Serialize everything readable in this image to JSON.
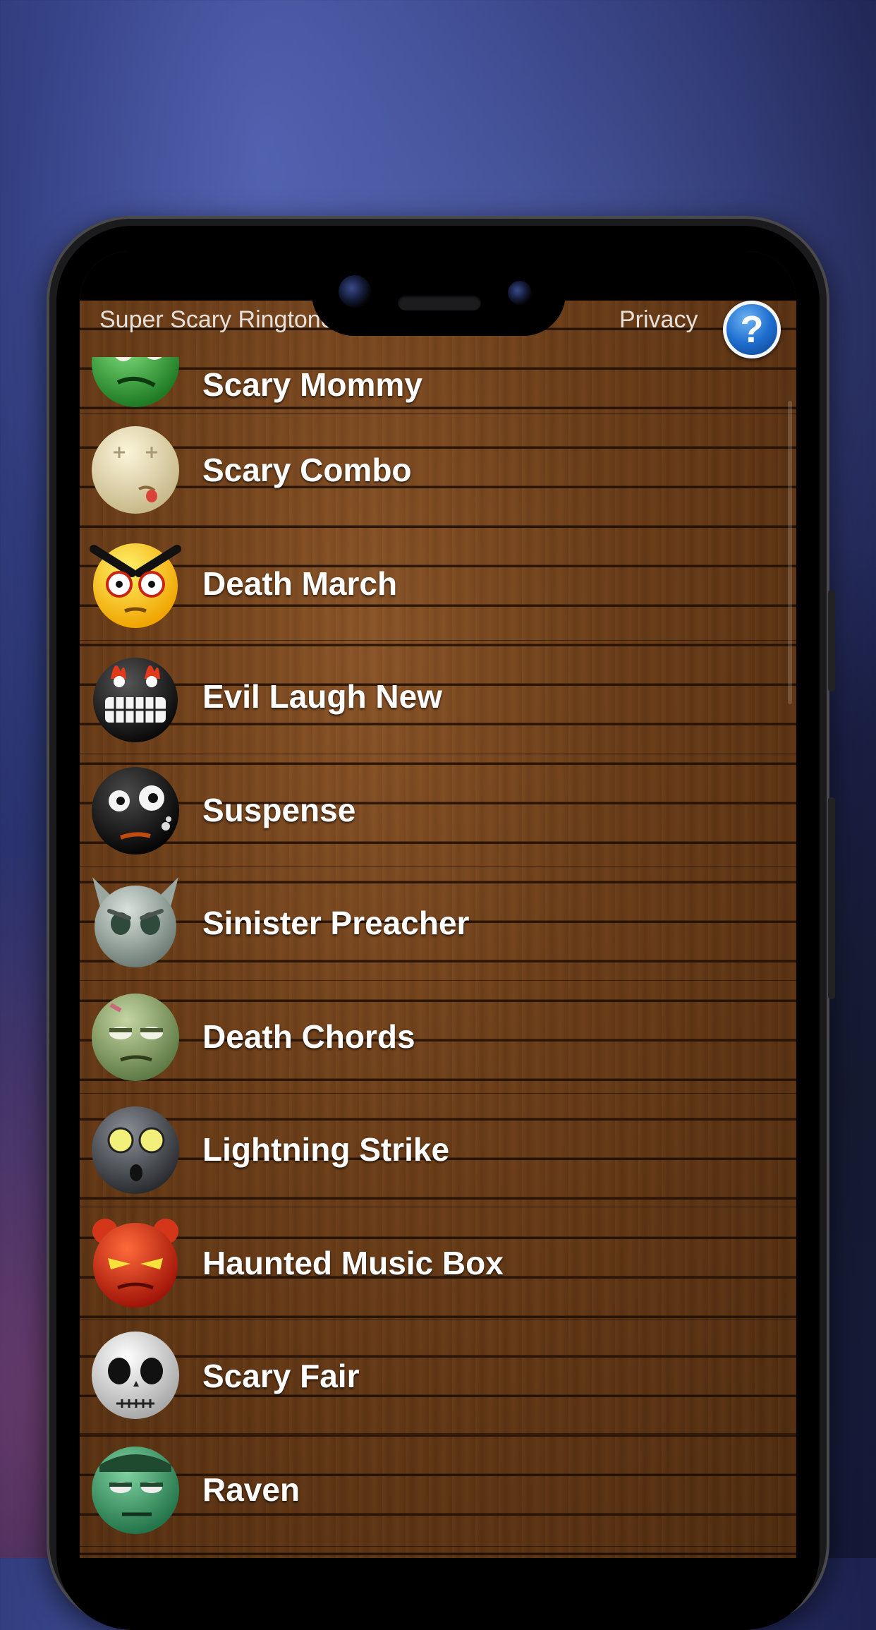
{
  "app": {
    "title": "Super Scary Ringtones",
    "privacy_label": "Privacy",
    "help_label": "?"
  },
  "ringtones": [
    {
      "name": "Scary Mommy",
      "icon": "green-zombie-face-icon"
    },
    {
      "name": "Scary Combo",
      "icon": "pale-dead-face-icon"
    },
    {
      "name": "Death March",
      "icon": "angry-yellow-face-icon"
    },
    {
      "name": "Evil Laugh New",
      "icon": "black-fire-eyed-face-icon"
    },
    {
      "name": "Suspense",
      "icon": "black-bomb-face-icon"
    },
    {
      "name": "Sinister Preacher",
      "icon": "gray-horned-face-icon"
    },
    {
      "name": "Death Chords",
      "icon": "green-tired-zombie-face-icon"
    },
    {
      "name": "Lightning Strike",
      "icon": "gray-glowing-eyes-face-icon"
    },
    {
      "name": "Haunted Music Box",
      "icon": "red-devil-face-icon"
    },
    {
      "name": "Scary Fair",
      "icon": "skull-face-icon"
    },
    {
      "name": "Raven",
      "icon": "frankenstein-face-icon"
    }
  ]
}
